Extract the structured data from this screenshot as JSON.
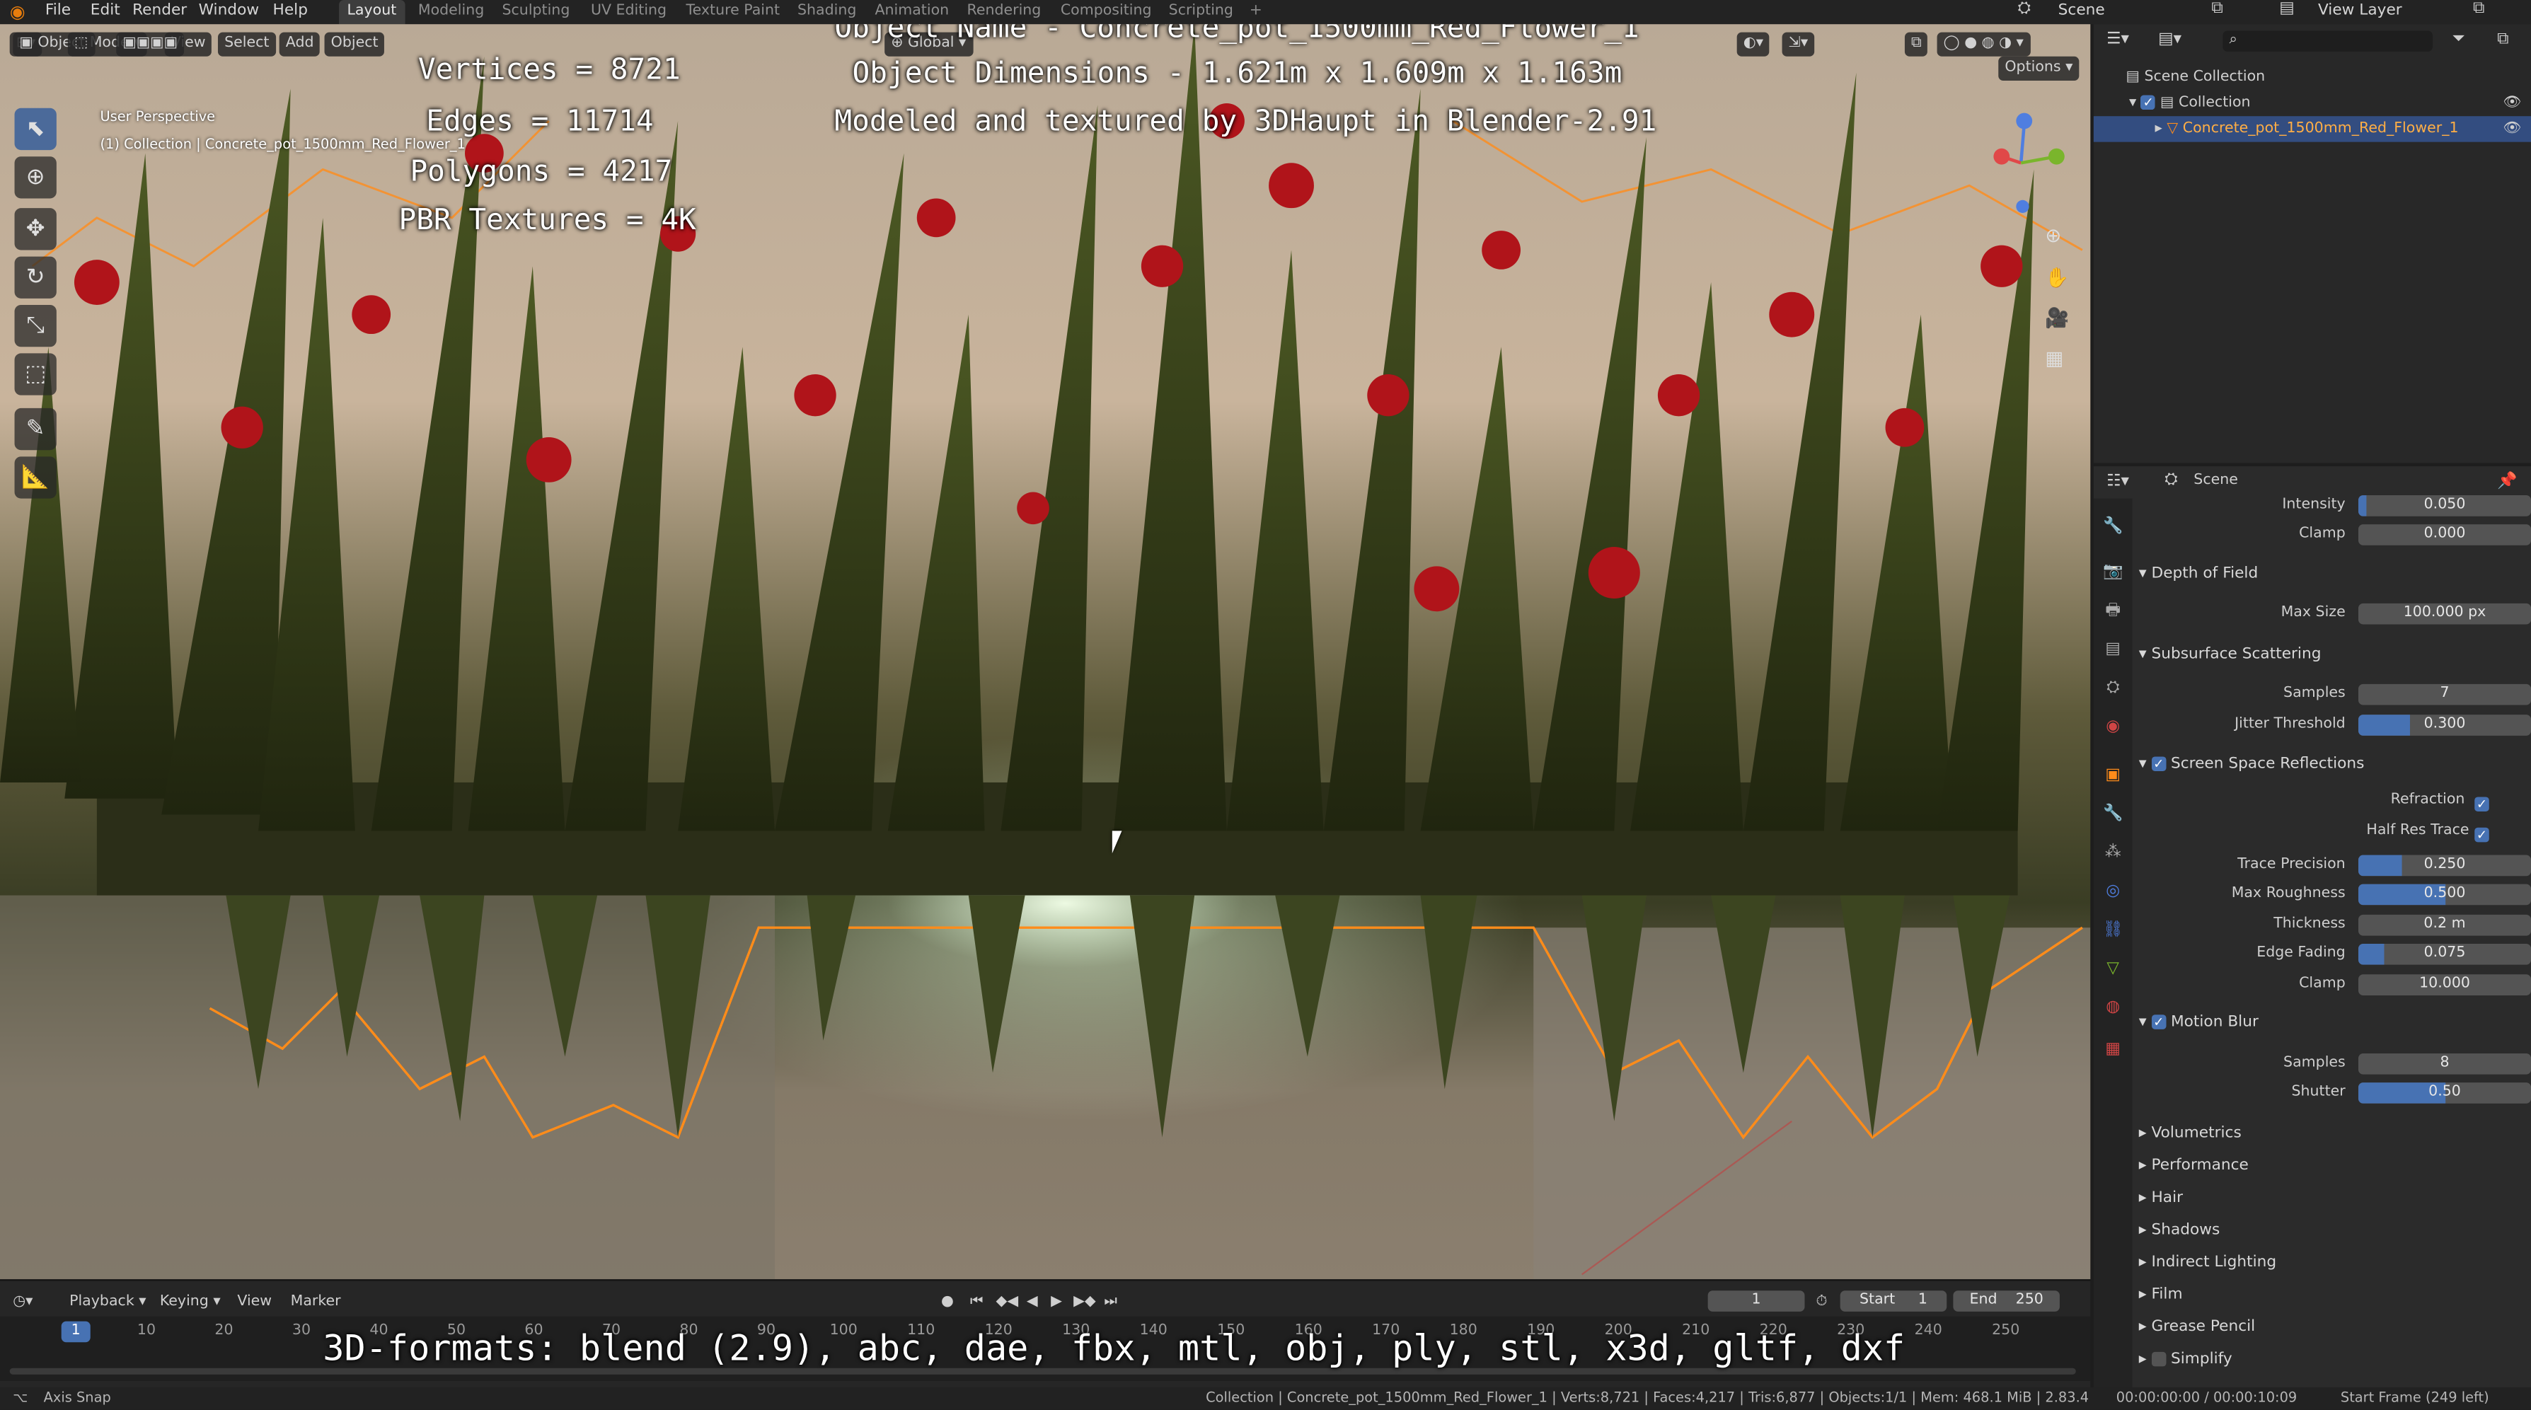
{
  "topbar": {
    "menus": [
      "File",
      "Edit",
      "Render",
      "Window",
      "Help"
    ],
    "workspaces": [
      "Layout",
      "Modeling",
      "Sculpting",
      "UV Editing",
      "Texture Paint",
      "Shading",
      "Animation",
      "Rendering",
      "Compositing",
      "Scripting"
    ],
    "active_workspace": "Layout",
    "scene_label": "Scene",
    "view_layer_label": "View Layer"
  },
  "viewport": {
    "mode": "Object Mode",
    "menus": [
      "View",
      "Select",
      "Add",
      "Object"
    ],
    "transform_orientation": "Global",
    "options_label": "Options",
    "perspective_label": "User Perspective",
    "collection_label": "(1) Collection | Concrete_pot_1500mm_Red_Flower_1",
    "overlay_stats": [
      "Vertices = 8721",
      "Edges = 11714",
      "Polygons = 4217",
      "PBR Textures = 4K"
    ],
    "overlay_title": [
      "Object Name - Concrete_pot_1500mm_Red_Flower_1",
      "Object Dimensions -  1.621m x 1.609m x 1.163m",
      "Modeled and textured by 3DHaupt in Blender-2.91"
    ],
    "formats_caption": "3D-formats: blend (2.9), abc, dae, fbx, mtl, obj, ply, stl, x3d, gltf, dxf"
  },
  "timeline": {
    "menus": [
      "Playback",
      "Keying",
      "View",
      "Marker"
    ],
    "current_frame": "1",
    "start_label": "Start",
    "start_value": "1",
    "end_label": "End",
    "end_value": "250",
    "ticks": [
      "1",
      "10",
      "20",
      "30",
      "40",
      "50",
      "60",
      "70",
      "80",
      "90",
      "100",
      "110",
      "120",
      "130",
      "140",
      "150",
      "160",
      "170",
      "180",
      "190",
      "200",
      "210",
      "220",
      "230",
      "240",
      "250"
    ]
  },
  "outliner": {
    "rows": [
      "Scene Collection",
      "Collection",
      "Concrete_pot_1500mm_Red_Flower_1"
    ]
  },
  "properties": {
    "context_label": "Scene",
    "top_rows": [
      {
        "label": "Intensity",
        "value": "0.050",
        "fill": 0.05
      },
      {
        "label": "Clamp",
        "value": "0.000",
        "fill": 0
      }
    ],
    "depth_of_field": {
      "title": "Depth of Field",
      "rows": [
        {
          "label": "Max Size",
          "value": "100.000 px",
          "fill": 0
        }
      ]
    },
    "subsurface": {
      "title": "Subsurface Scattering",
      "rows": [
        {
          "label": "Samples",
          "value": "7",
          "fill": 0
        },
        {
          "label": "Jitter Threshold",
          "value": "0.300",
          "fill": 0.3
        }
      ]
    },
    "ssr": {
      "title": "Screen Space Reflections",
      "checks": [
        {
          "label": "Refraction"
        },
        {
          "label": "Half Res Trace"
        }
      ],
      "rows": [
        {
          "label": "Trace Precision",
          "value": "0.250",
          "fill": 0.25
        },
        {
          "label": "Max Roughness",
          "value": "0.500",
          "fill": 0.5
        },
        {
          "label": "Thickness",
          "value": "0.2 m",
          "fill": 0
        },
        {
          "label": "Edge Fading",
          "value": "0.075",
          "fill": 0.15
        },
        {
          "label": "Clamp",
          "value": "10.000",
          "fill": 0
        }
      ]
    },
    "motion_blur": {
      "title": "Motion Blur",
      "rows": [
        {
          "label": "Samples",
          "value": "8",
          "fill": 0
        },
        {
          "label": "Shutter",
          "value": "0.50",
          "fill": 0.5
        }
      ]
    },
    "collapsed": [
      "Volumetrics",
      "Performance",
      "Hair",
      "Shadows",
      "Indirect Lighting",
      "Film",
      "Grease Pencil",
      "Simplify"
    ]
  },
  "statusbar": {
    "left": "Axis Snap",
    "center": "Collection | Concrete_pot_1500mm_Red_Flower_1 | Verts:8,721 | Faces:4,217 | Tris:6,877 | Objects:1/1 | Mem: 468.1 MiB | 2.83.4",
    "time": "00:00:00:00 / 00:00:10:09",
    "right": "Start Frame (249 left)"
  },
  "colors": {
    "accent": "#4772b3",
    "selection": "#ff8c1a",
    "flower": "#b0141a",
    "leaf": "#3b4a1c"
  }
}
